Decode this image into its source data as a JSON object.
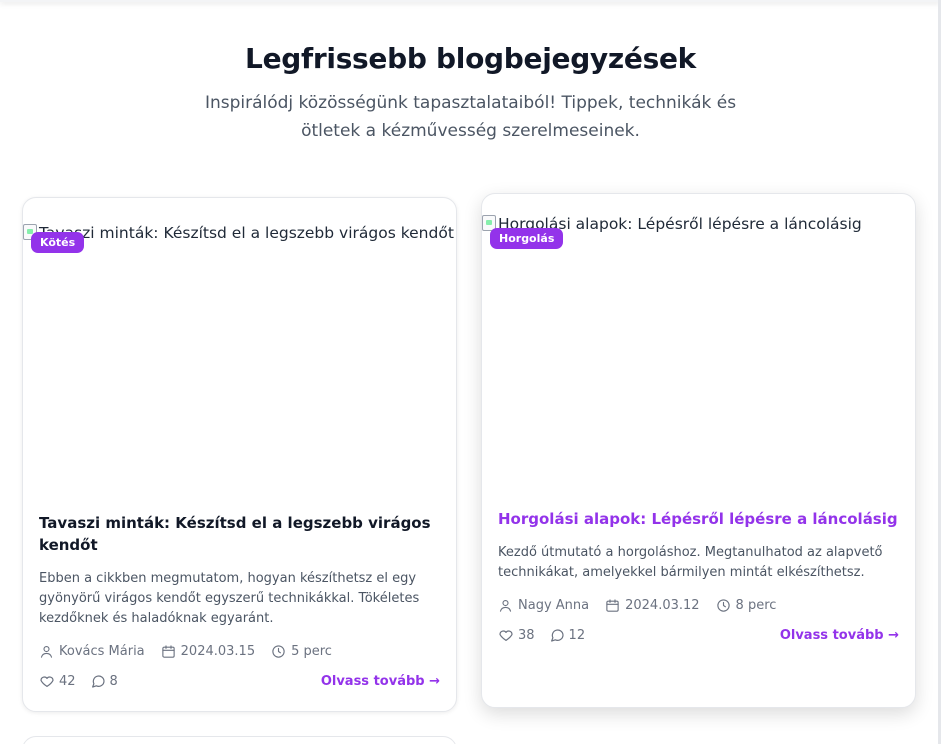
{
  "section": {
    "title": "Legfrissebb blogbejegyzések",
    "subtitle": "Inspirálódj közösségünk tapasztalataiból! Tippek, technikák és ötletek a kézművesség szerelmeseinek."
  },
  "posts": [
    {
      "image_alt": "Tavaszi minták: Készítsd el a legszebb virágos kendőt",
      "category": "Kötés",
      "title": "Tavaszi minták: Készítsd el a legszebb virágos kendőt",
      "excerpt": "Ebben a cikkben megmutatom, hogyan készíthetsz el egy gyönyörű virágos kendőt egyszerű technikákkal. Tökéletes kezdőknek és haladóknak egyaránt.",
      "author": "Kovács Mária",
      "date": "2024.03.15",
      "read_time": "5 perc",
      "likes": "42",
      "comments": "8",
      "read_more": "Olvass tovább →"
    },
    {
      "image_alt": "Horgolási alapok: Lépésről lépésre a láncolásig",
      "category": "Horgolás",
      "title": "Horgolási alapok: Lépésről lépésre a láncolásig",
      "excerpt": "Kezdő útmutató a horgoláshoz. Megtanulhatod az alapvető technikákat, amelyekkel bármilyen mintát elkészíthetsz.",
      "author": "Nagy Anna",
      "date": "2024.03.12",
      "read_time": "8 perc",
      "likes": "38",
      "comments": "12",
      "read_more": "Olvass tovább →"
    }
  ],
  "colors": {
    "accent": "#9333ea",
    "text": "#111827",
    "muted": "#6b7280"
  },
  "icons": [
    "user-icon",
    "calendar-icon",
    "clock-icon",
    "heart-icon",
    "comment-icon",
    "broken-image-icon"
  ]
}
